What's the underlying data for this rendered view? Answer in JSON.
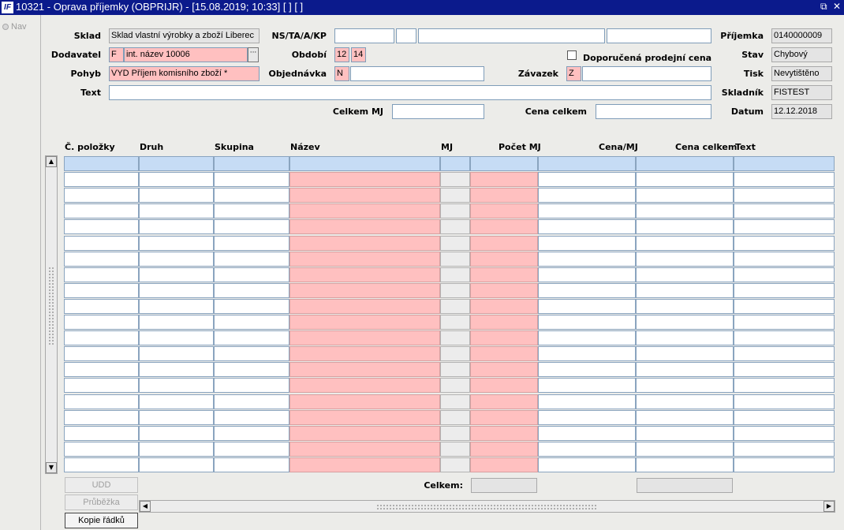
{
  "window": {
    "title": "10321 - Oprava příjemky (OBPRIJR) - [15.08.2019; 10:33]  [ ]  [ ]",
    "logo": "IF",
    "restore_glyph": "⧉",
    "close_glyph": "✕"
  },
  "nav": {
    "label": "Nav"
  },
  "header": {
    "sklad_label": "Sklad",
    "sklad_value": "Sklad vlastní výrobky a zboží Liberec",
    "dodavatel_label": "Dodavatel",
    "dodavatel_code": "F",
    "dodavatel_value": "int. název 10006",
    "lov_glyph": "···",
    "pohyb_label": "Pohyb",
    "pohyb_value": "VYD Příjem komisního zboží *",
    "text_label": "Text",
    "text_value": "",
    "ns_label": "NS/TA/A/KP",
    "ns_values": [
      "",
      "",
      "",
      ""
    ],
    "obdobi_label": "Období",
    "obdobi_month": "12",
    "obdobi_year": "14",
    "objednavka_label": "Objednávka",
    "objednavka_code": "N",
    "objednavka_value": "",
    "doporucena_label": "Doporučená prodejní cena",
    "doporucena_checked": false,
    "zavazek_label": "Závazek",
    "zavazek_code": "Z",
    "zavazek_value": "",
    "celkem_mj_label": "Celkem MJ",
    "celkem_mj_value": "",
    "cena_celkem_label": "Cena celkem",
    "cena_celkem_value": "",
    "prijemka_label": "Příjemka",
    "prijemka_value": "0140000009",
    "stav_label": "Stav",
    "stav_value": "Chybový",
    "tisk_label": "Tisk",
    "tisk_value": "Nevytištěno",
    "skladnik_label": "Skladník",
    "skladnik_value": "FISTEST",
    "datum_label": "Datum",
    "datum_value": "12.12.2018"
  },
  "grid": {
    "columns": [
      "Č. položky",
      "Druh",
      "Skupina",
      "Název",
      "MJ",
      "Počet MJ",
      "Cena/MJ",
      "Cena celkem",
      "Text"
    ],
    "row_count": 20,
    "colors": {
      "required": "#ffc0c0",
      "readonly": "#ececec",
      "current": "#c6dcf5"
    }
  },
  "footer": {
    "celkem_label": "Celkem:",
    "celkem_pocet": "",
    "celkem_cena": "",
    "udd_label": "UDD",
    "prubezka_label": "Průběžka",
    "kopie_label": "Kopie řádků"
  },
  "scroll": {
    "up": "▲",
    "down": "▼",
    "left": "◀",
    "right": "▶"
  }
}
